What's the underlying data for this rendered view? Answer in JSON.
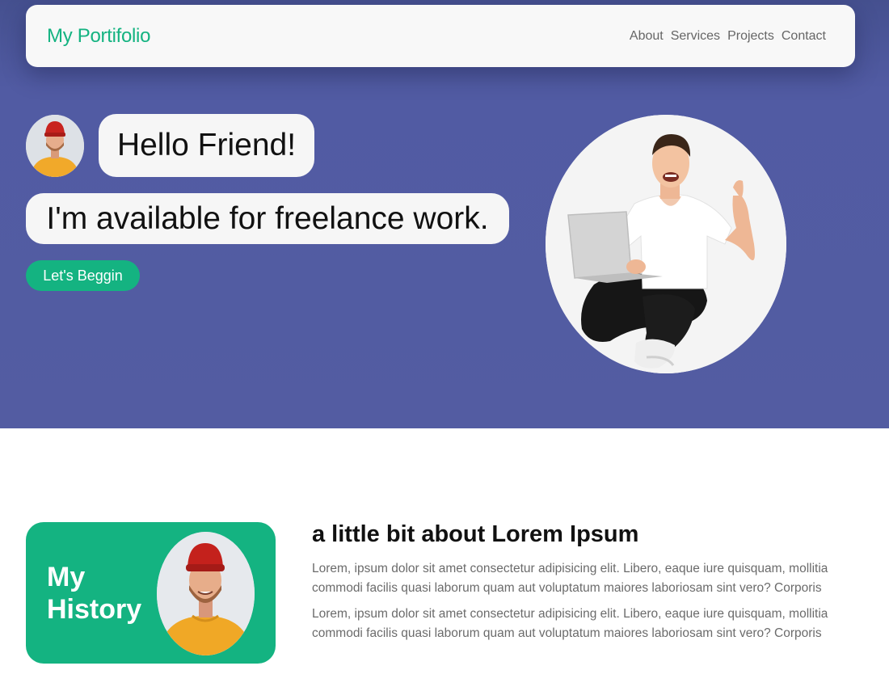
{
  "nav": {
    "brand": "My Portifolio",
    "links": [
      "About",
      "Services",
      "Projects",
      "Contact"
    ]
  },
  "hero": {
    "greeting": "Hello Friend!",
    "tagline": "I'm available for freelance work.",
    "cta_label": "Let's Beggin"
  },
  "about": {
    "card_title_line1": "My",
    "card_title_line2": "History",
    "heading": "a little bit about Lorem Ipsum",
    "paragraphs": [
      "Lorem, ipsum dolor sit amet consectetur adipisicing elit. Libero, eaque iure quisquam, mollitia commodi facilis quasi laborum quam aut voluptatum maiores laboriosam sint vero? Corporis",
      "Lorem, ipsum dolor sit amet consectetur adipisicing elit. Libero, eaque iure quisquam, mollitia commodi facilis quasi laborum quam aut voluptatum maiores laboriosam sint vero? Corporis"
    ]
  },
  "colors": {
    "accent": "#14b381",
    "hero_bg": "#535ca2",
    "nav_bg": "#f8f8f8",
    "bubble_bg": "#f6f6f6",
    "body_text": "#6b6b6b"
  },
  "icons": {
    "avatar": "man-red-beanie-portrait",
    "hero_photo": "man-with-laptop-thumbs-up",
    "history_photo": "man-red-beanie-portrait"
  }
}
